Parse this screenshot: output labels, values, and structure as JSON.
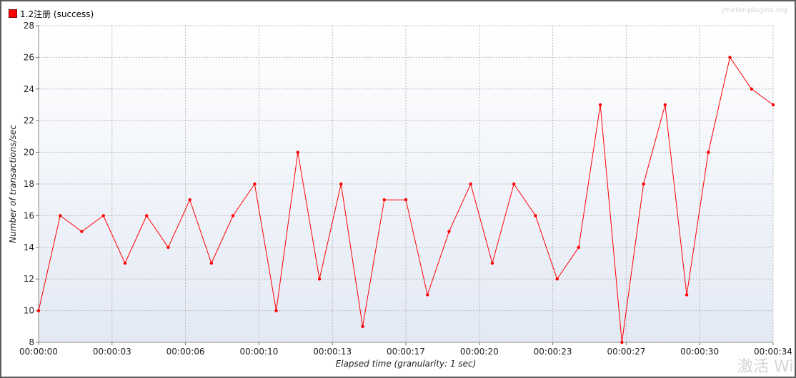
{
  "legend": {
    "label": "1.2注册 (success)",
    "color": "#ff0000"
  },
  "watermark": "jmeter-plugins.org",
  "activate_text": "激活 Wi",
  "chart_data": {
    "type": "line",
    "title": "",
    "xlabel": "Elapsed time (granularity: 1 sec)",
    "ylabel": "Number of transactions/sec",
    "ylim": [
      8,
      28
    ],
    "yticks": [
      8,
      10,
      12,
      14,
      16,
      18,
      20,
      22,
      24,
      26,
      28
    ],
    "xlim": [
      0,
      34
    ],
    "xticks": [
      {
        "value": 0,
        "label": "00:00:00"
      },
      {
        "value": 3.4,
        "label": "00:00:03"
      },
      {
        "value": 6.8,
        "label": "00:00:06"
      },
      {
        "value": 10.2,
        "label": "00:00:10"
      },
      {
        "value": 13.6,
        "label": "00:00:13"
      },
      {
        "value": 17,
        "label": "00:00:17"
      },
      {
        "value": 20.4,
        "label": "00:00:20"
      },
      {
        "value": 23.8,
        "label": "00:00:23"
      },
      {
        "value": 27.2,
        "label": "00:00:27"
      },
      {
        "value": 30.6,
        "label": "00:00:30"
      },
      {
        "value": 34,
        "label": "00:00:34"
      }
    ],
    "grid": true,
    "series": [
      {
        "name": "1.2注册 (success)",
        "color": "#ff0000",
        "x": [
          0,
          1,
          2,
          3,
          4,
          5,
          6,
          7,
          8,
          9,
          10,
          11,
          12,
          13,
          14,
          15,
          16,
          17,
          18,
          19,
          20,
          21,
          22,
          23,
          24,
          25,
          26,
          27,
          28,
          29,
          30,
          31,
          32,
          33,
          34
        ],
        "values": [
          10,
          16,
          15,
          16,
          13,
          16,
          14,
          17,
          13,
          16,
          18,
          10,
          20,
          12,
          18,
          9,
          17,
          17,
          11,
          15,
          18,
          13,
          18,
          16,
          12,
          14,
          23,
          8,
          18,
          23,
          11,
          20,
          26,
          24,
          23
        ]
      }
    ]
  }
}
